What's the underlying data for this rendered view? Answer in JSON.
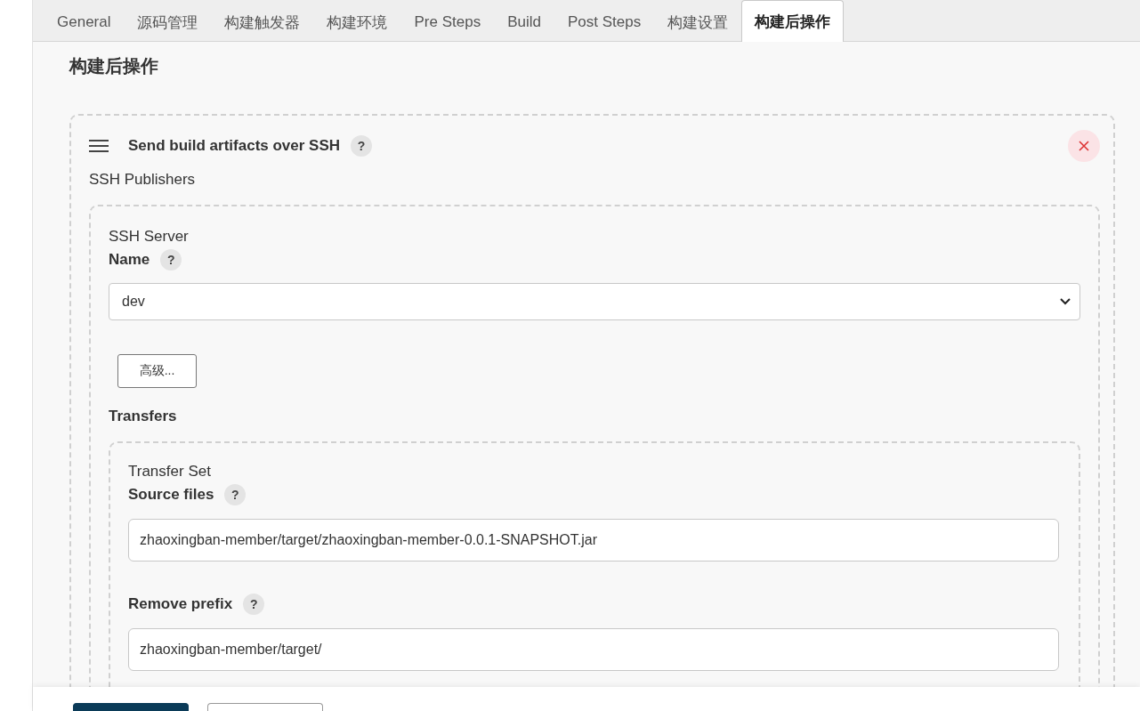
{
  "tabs": [
    {
      "label": "General",
      "selected": false
    },
    {
      "label": "源码管理",
      "selected": false
    },
    {
      "label": "构建触发器",
      "selected": false
    },
    {
      "label": "构建环境",
      "selected": false
    },
    {
      "label": "Pre Steps",
      "selected": false
    },
    {
      "label": "Build",
      "selected": false
    },
    {
      "label": "Post Steps",
      "selected": false
    },
    {
      "label": "构建设置",
      "selected": false
    },
    {
      "label": "构建后操作",
      "selected": true
    }
  ],
  "section_title": "构建后操作",
  "step": {
    "title": "Send build artifacts over SSH",
    "help": "?",
    "publishers_label": "SSH Publishers",
    "server": {
      "caption": "SSH Server",
      "name_label": "Name",
      "help": "?",
      "value": "dev",
      "advanced_button": "高级..."
    },
    "transfers_label": "Transfers",
    "transfer_set": {
      "caption": "Transfer Set",
      "fields": [
        {
          "label": "Source files",
          "help": "?",
          "value": "zhaoxingban-member/target/zhaoxingban-member-0.0.1-SNAPSHOT.jar"
        },
        {
          "label": "Remove prefix",
          "help": "?",
          "value": "zhaoxingban-member/target/"
        }
      ]
    }
  },
  "footer": {
    "buttons": [
      {
        "kind": "primary"
      },
      {
        "kind": "secondary"
      }
    ]
  }
}
